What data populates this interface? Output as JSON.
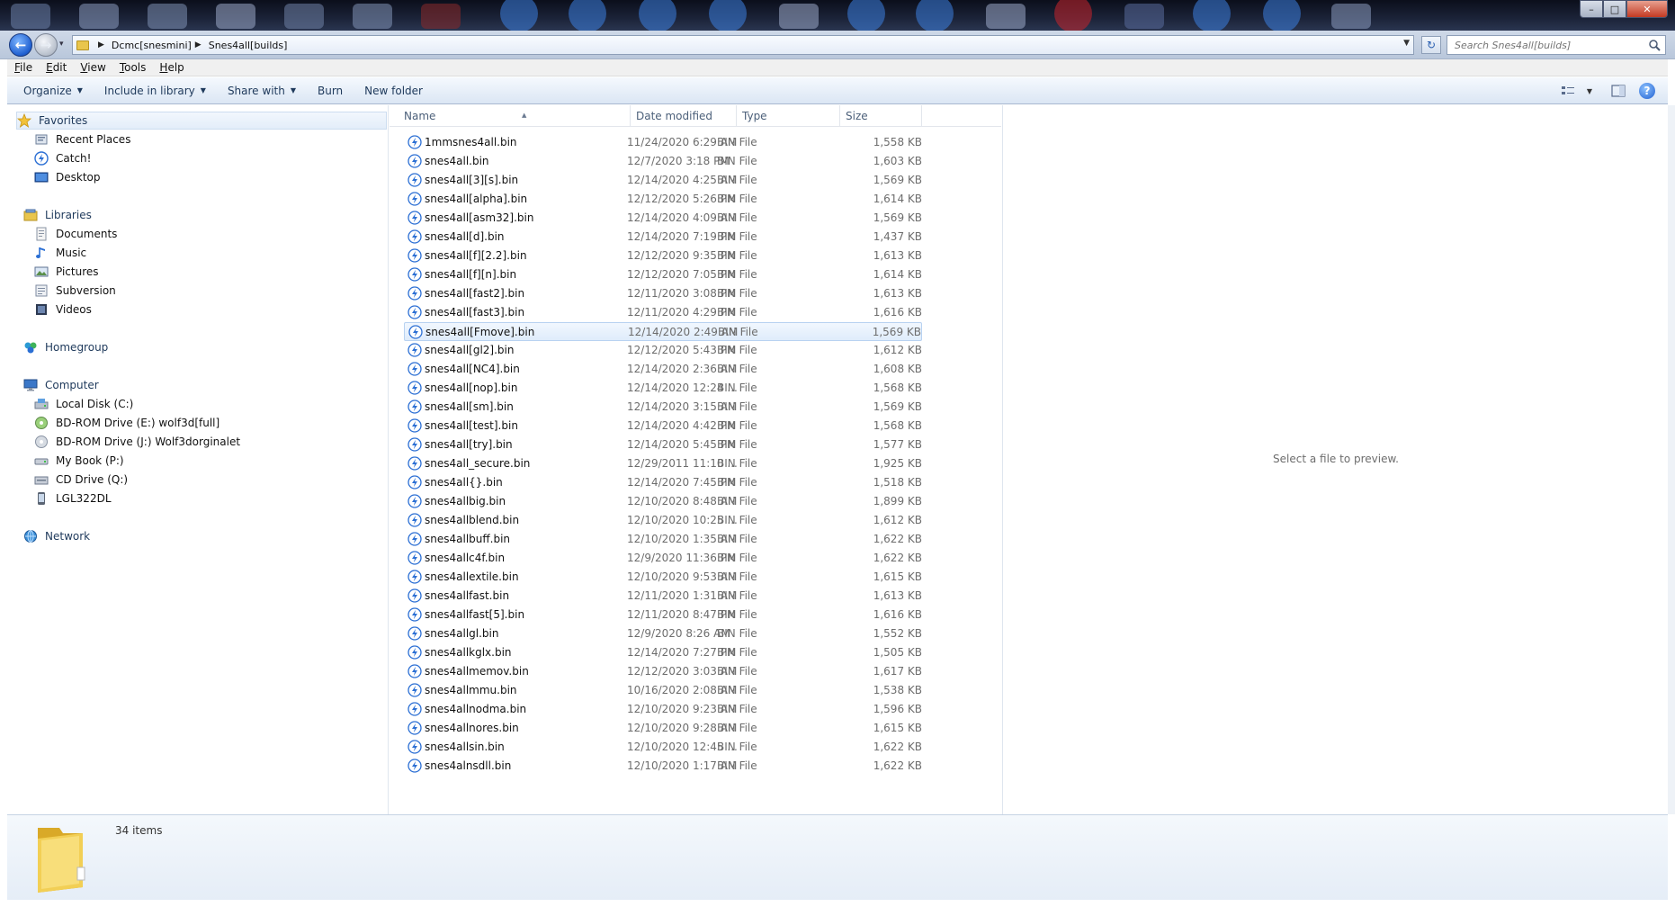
{
  "window": {
    "controls": {
      "minimize": "–",
      "maximize": "□",
      "close": "✕"
    }
  },
  "address": {
    "breadcrumbs": [
      "Dcmc[snesmini]",
      "Snes4all[builds]"
    ],
    "search_placeholder": "Search Snes4all[builds]"
  },
  "menubar": [
    "File",
    "Edit",
    "View",
    "Tools",
    "Help"
  ],
  "commandbar": {
    "organize": "Organize",
    "include_in_library": "Include in library",
    "share_with": "Share with",
    "burn": "Burn",
    "new_folder": "New folder"
  },
  "navpane": {
    "favorites": {
      "label": "Favorites",
      "items": [
        "Recent Places",
        "Catch!",
        "Desktop"
      ]
    },
    "libraries": {
      "label": "Libraries",
      "items": [
        "Documents",
        "Music",
        "Pictures",
        "Subversion",
        "Videos"
      ]
    },
    "homegroup": "Homegroup",
    "computer": {
      "label": "Computer",
      "items": [
        "Local Disk (C:)",
        "BD-ROM Drive (E:) wolf3d[full]",
        "BD-ROM Drive (J:) Wolf3dorginalet",
        "My Book (P:)",
        "CD Drive (Q:)",
        "LGL322DL"
      ]
    },
    "network": "Network"
  },
  "filelist": {
    "columns": {
      "name": "Name",
      "date": "Date modified",
      "type": "Type",
      "size": "Size"
    },
    "selected_index": 10,
    "files": [
      {
        "name": "1mmsnes4all.bin",
        "date": "11/24/2020 6:29 AM",
        "type": "BIN File",
        "size": "1,558 KB"
      },
      {
        "name": "snes4all.bin",
        "date": "12/7/2020 3:18 PM",
        "type": "BIN File",
        "size": "1,603 KB"
      },
      {
        "name": "snes4all[3][s].bin",
        "date": "12/14/2020 4:25 AM",
        "type": "BIN File",
        "size": "1,569 KB"
      },
      {
        "name": "snes4all[alpha].bin",
        "date": "12/12/2020 5:26 PM",
        "type": "BIN File",
        "size": "1,614 KB"
      },
      {
        "name": "snes4all[asm32].bin",
        "date": "12/14/2020 4:09 AM",
        "type": "BIN File",
        "size": "1,569 KB"
      },
      {
        "name": "snes4all[d].bin",
        "date": "12/14/2020 7:19 PM",
        "type": "BIN File",
        "size": "1,437 KB"
      },
      {
        "name": "snes4all[f][2.2].bin",
        "date": "12/12/2020 9:35 PM",
        "type": "BIN File",
        "size": "1,613 KB"
      },
      {
        "name": "snes4all[f][n].bin",
        "date": "12/12/2020 7:05 PM",
        "type": "BIN File",
        "size": "1,614 KB"
      },
      {
        "name": "snes4all[fast2].bin",
        "date": "12/11/2020 3:08 PM",
        "type": "BIN File",
        "size": "1,613 KB"
      },
      {
        "name": "snes4all[fast3].bin",
        "date": "12/11/2020 4:29 PM",
        "type": "BIN File",
        "size": "1,616 KB"
      },
      {
        "name": "snes4all[Fmove].bin",
        "date": "12/14/2020 2:49 AM",
        "type": "BIN File",
        "size": "1,569 KB"
      },
      {
        "name": "snes4all[gl2].bin",
        "date": "12/12/2020 5:43 PM",
        "type": "BIN File",
        "size": "1,612 KB"
      },
      {
        "name": "snes4all[NC4].bin",
        "date": "12/14/2020 2:36 AM",
        "type": "BIN File",
        "size": "1,608 KB"
      },
      {
        "name": "snes4all[nop].bin",
        "date": "12/14/2020 12:24 ...",
        "type": "BIN File",
        "size": "1,568 KB"
      },
      {
        "name": "snes4all[sm].bin",
        "date": "12/14/2020 3:15 AM",
        "type": "BIN File",
        "size": "1,569 KB"
      },
      {
        "name": "snes4all[test].bin",
        "date": "12/14/2020 4:42 PM",
        "type": "BIN File",
        "size": "1,568 KB"
      },
      {
        "name": "snes4all[try].bin",
        "date": "12/14/2020 5:45 PM",
        "type": "BIN File",
        "size": "1,577 KB"
      },
      {
        "name": "snes4all_secure.bin",
        "date": "12/29/2011 11:10 ...",
        "type": "BIN File",
        "size": "1,925 KB"
      },
      {
        "name": "snes4all{}.bin",
        "date": "12/14/2020 7:45 PM",
        "type": "BIN File",
        "size": "1,518 KB"
      },
      {
        "name": "snes4allbig.bin",
        "date": "12/10/2020 8:48 AM",
        "type": "BIN File",
        "size": "1,899 KB"
      },
      {
        "name": "snes4allblend.bin",
        "date": "12/10/2020 10:25 ...",
        "type": "BIN File",
        "size": "1,612 KB"
      },
      {
        "name": "snes4allbuff.bin",
        "date": "12/10/2020 1:35 AM",
        "type": "BIN File",
        "size": "1,622 KB"
      },
      {
        "name": "snes4allc4f.bin",
        "date": "12/9/2020 11:36 PM",
        "type": "BIN File",
        "size": "1,622 KB"
      },
      {
        "name": "snes4allextile.bin",
        "date": "12/10/2020 9:53 AM",
        "type": "BIN File",
        "size": "1,615 KB"
      },
      {
        "name": "snes4allfast.bin",
        "date": "12/11/2020 1:31 AM",
        "type": "BIN File",
        "size": "1,613 KB"
      },
      {
        "name": "snes4allfast[5].bin",
        "date": "12/11/2020 8:47 PM",
        "type": "BIN File",
        "size": "1,616 KB"
      },
      {
        "name": "snes4allgl.bin",
        "date": "12/9/2020 8:26 AM",
        "type": "BIN File",
        "size": "1,552 KB"
      },
      {
        "name": "snes4allkglx.bin",
        "date": "12/14/2020 7:27 PM",
        "type": "BIN File",
        "size": "1,505 KB"
      },
      {
        "name": "snes4allmemov.bin",
        "date": "12/12/2020 3:03 AM",
        "type": "BIN File",
        "size": "1,617 KB"
      },
      {
        "name": "snes4allmmu.bin",
        "date": "10/16/2020 2:08 AM",
        "type": "BIN File",
        "size": "1,538 KB"
      },
      {
        "name": "snes4allnodma.bin",
        "date": "12/10/2020 9:23 AM",
        "type": "BIN File",
        "size": "1,596 KB"
      },
      {
        "name": "snes4allnores.bin",
        "date": "12/10/2020 9:28 AM",
        "type": "BIN File",
        "size": "1,615 KB"
      },
      {
        "name": "snes4allsin.bin",
        "date": "12/10/2020 12:45 ...",
        "type": "BIN File",
        "size": "1,622 KB"
      },
      {
        "name": "snes4alnsdll.bin",
        "date": "12/10/2020 1:17 AM",
        "type": "BIN File",
        "size": "1,622 KB"
      }
    ]
  },
  "preview": {
    "message": "Select a file to preview."
  },
  "details": {
    "item_count": "34 items"
  },
  "colors": {
    "accent": "#1f5fd0",
    "selection": "#dfecfb",
    "folder": "#e9c54c"
  }
}
